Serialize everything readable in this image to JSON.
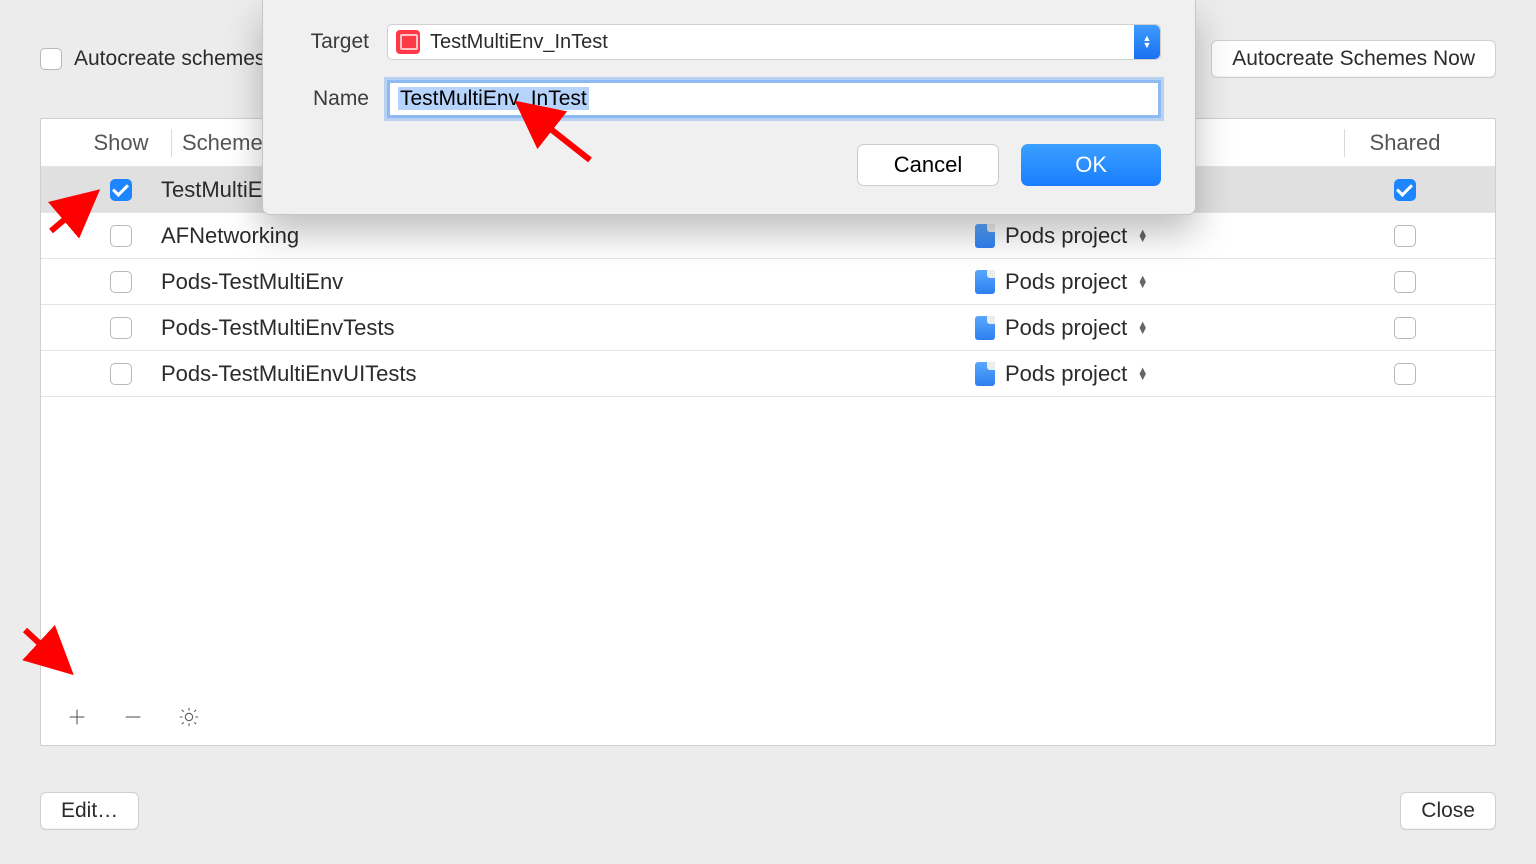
{
  "topbar": {
    "autocreate_label": "Autocreate schemes",
    "autocreate_now_label": "Autocreate Schemes Now"
  },
  "headers": {
    "show": "Show",
    "scheme": "Scheme",
    "shared": "Shared"
  },
  "rows": [
    {
      "show": true,
      "scheme": "TestMultiEnv_InTest",
      "container": "",
      "shared": true,
      "selected": true
    },
    {
      "show": false,
      "scheme": "AFNetworking",
      "container": "Pods project",
      "shared": false,
      "selected": false
    },
    {
      "show": false,
      "scheme": "Pods-TestMultiEnv",
      "container": "Pods project",
      "shared": false,
      "selected": false
    },
    {
      "show": false,
      "scheme": "Pods-TestMultiEnvTests",
      "container": "Pods project",
      "shared": false,
      "selected": false
    },
    {
      "show": false,
      "scheme": "Pods-TestMultiEnvUITests",
      "container": "Pods project",
      "shared": false,
      "selected": false
    }
  ],
  "footer": {
    "edit_label": "Edit…",
    "close_label": "Close"
  },
  "sheet": {
    "target_label": "Target",
    "target_value": "TestMultiEnv_InTest",
    "name_label": "Name",
    "name_value": "TestMultiEnv_InTest",
    "cancel_label": "Cancel",
    "ok_label": "OK"
  }
}
